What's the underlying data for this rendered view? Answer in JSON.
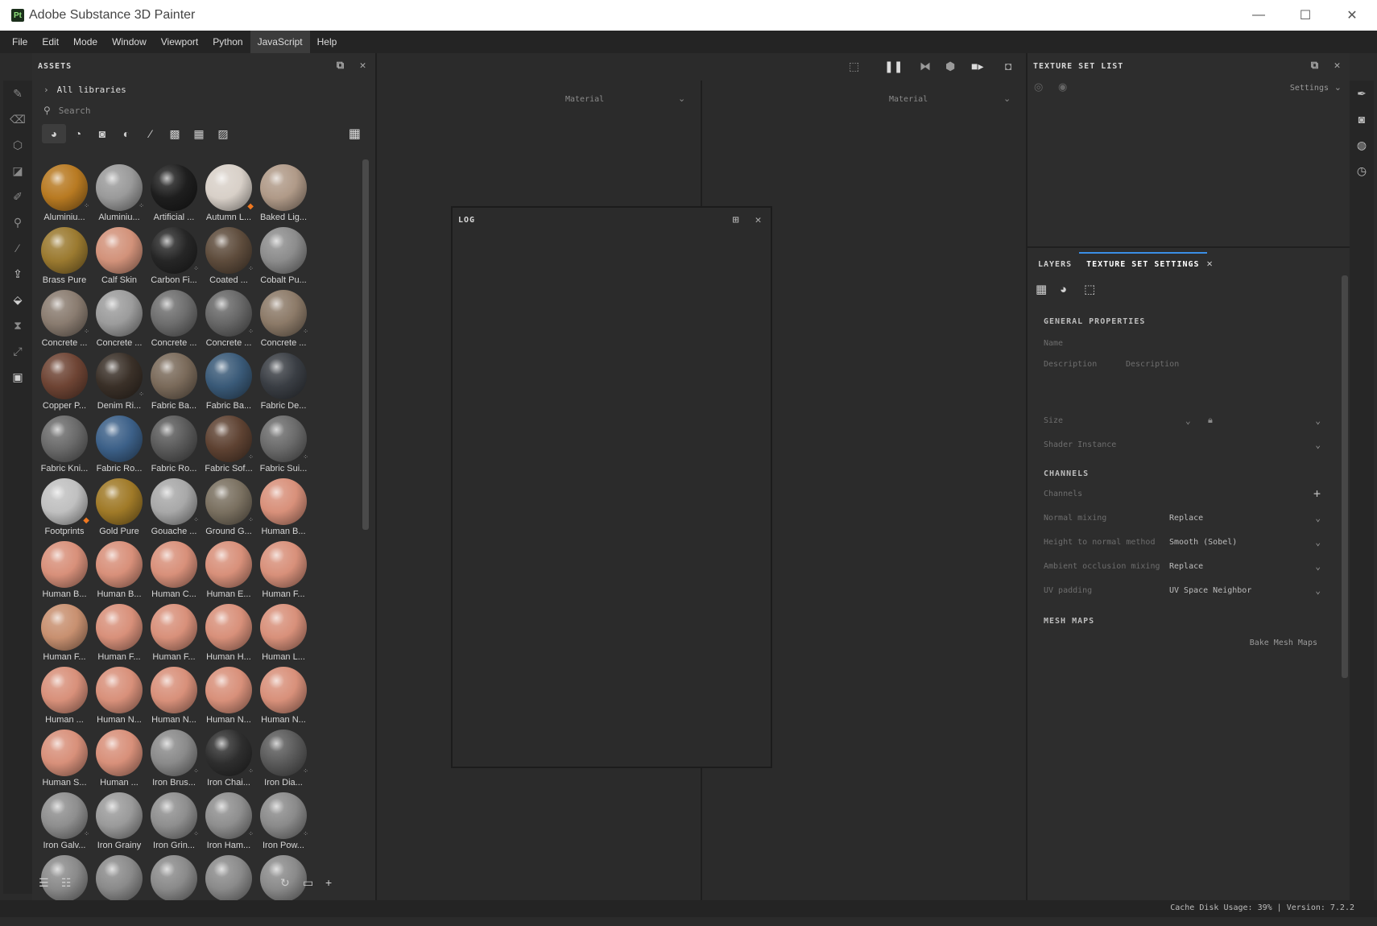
{
  "window": {
    "logo": "Pt",
    "title": "Adobe Substance 3D Painter",
    "minimize": "—",
    "maximize": "☐",
    "close": "✕"
  },
  "menu": [
    "File",
    "Edit",
    "Mode",
    "Window",
    "Viewport",
    "Python",
    "JavaScript",
    "Help"
  ],
  "assets": {
    "title": "ASSETS",
    "libraries": "All libraries",
    "search_placeholder": "Search",
    "items": [
      {
        "label": "Aluminiu...",
        "color": "#b87a22",
        "badge": "dots"
      },
      {
        "label": "Aluminiu...",
        "color": "#9a9a9a",
        "badge": "dots"
      },
      {
        "label": "Artificial ...",
        "color": "#1e1e1e",
        "badge": ""
      },
      {
        "label": "Autumn L...",
        "color": "#d8d0c8",
        "badge": "leaf"
      },
      {
        "label": "Baked Lig...",
        "color": "#b09a88",
        "badge": ""
      },
      {
        "label": "Brass Pure",
        "color": "#9b7a30",
        "badge": ""
      },
      {
        "label": "Calf Skin",
        "color": "#d2927a",
        "badge": ""
      },
      {
        "label": "Carbon Fi...",
        "color": "#262626",
        "badge": "dots"
      },
      {
        "label": "Coated ...",
        "color": "#5e4c3c",
        "badge": "dots"
      },
      {
        "label": "Cobalt Pu...",
        "color": "#8c8c8c",
        "badge": ""
      },
      {
        "label": "Concrete ...",
        "color": "#8a7c70",
        "badge": "dots"
      },
      {
        "label": "Concrete ...",
        "color": "#9c9c9c",
        "badge": ""
      },
      {
        "label": "Concrete ...",
        "color": "#6e6e6e",
        "badge": ""
      },
      {
        "label": "Concrete ...",
        "color": "#676767",
        "badge": "dots"
      },
      {
        "label": "Concrete ...",
        "color": "#8c7a68",
        "badge": "dots"
      },
      {
        "label": "Copper P...",
        "color": "#6e4434",
        "badge": ""
      },
      {
        "label": "Denim Ri...",
        "color": "#3a3028",
        "badge": "dots"
      },
      {
        "label": "Fabric Ba...",
        "color": "#7a6a5a",
        "badge": ""
      },
      {
        "label": "Fabric Ba...",
        "color": "#3a5a78",
        "badge": ""
      },
      {
        "label": "Fabric De...",
        "color": "#3a3e44",
        "badge": ""
      },
      {
        "label": "Fabric Kni...",
        "color": "#6a6a6a",
        "badge": ""
      },
      {
        "label": "Fabric Ro...",
        "color": "#3c6088",
        "badge": ""
      },
      {
        "label": "Fabric Ro...",
        "color": "#5a5a5a",
        "badge": ""
      },
      {
        "label": "Fabric Sof...",
        "color": "#5e4232",
        "badge": "dots"
      },
      {
        "label": "Fabric Sui...",
        "color": "#6a6a6a",
        "badge": "dots"
      },
      {
        "label": "Footprints",
        "color": "#c0c0c0",
        "badge": "leaf"
      },
      {
        "label": "Gold Pure",
        "color": "#a07a28",
        "badge": ""
      },
      {
        "label": "Gouache ...",
        "color": "#a8a8a8",
        "badge": "dots"
      },
      {
        "label": "Ground G...",
        "color": "#7a7060",
        "badge": "dots"
      },
      {
        "label": "Human B...",
        "color": "#d8907a",
        "badge": ""
      },
      {
        "label": "Human B...",
        "color": "#d8907a",
        "badge": ""
      },
      {
        "label": "Human B...",
        "color": "#d8907a",
        "badge": ""
      },
      {
        "label": "Human C...",
        "color": "#d8907a",
        "badge": ""
      },
      {
        "label": "Human E...",
        "color": "#d8907a",
        "badge": ""
      },
      {
        "label": "Human F...",
        "color": "#d8907a",
        "badge": ""
      },
      {
        "label": "Human F...",
        "color": "#c89070",
        "badge": ""
      },
      {
        "label": "Human F...",
        "color": "#d8907a",
        "badge": ""
      },
      {
        "label": "Human F...",
        "color": "#d8907a",
        "badge": ""
      },
      {
        "label": "Human H...",
        "color": "#d8907a",
        "badge": ""
      },
      {
        "label": "Human L...",
        "color": "#d8907a",
        "badge": ""
      },
      {
        "label": "Human ...",
        "color": "#d8907a",
        "badge": ""
      },
      {
        "label": "Human N...",
        "color": "#d8907a",
        "badge": ""
      },
      {
        "label": "Human N...",
        "color": "#d8907a",
        "badge": ""
      },
      {
        "label": "Human N...",
        "color": "#d8907a",
        "badge": ""
      },
      {
        "label": "Human N...",
        "color": "#d8907a",
        "badge": ""
      },
      {
        "label": "Human S...",
        "color": "#d8907a",
        "badge": ""
      },
      {
        "label": "Human ...",
        "color": "#d8907a",
        "badge": ""
      },
      {
        "label": "Iron Brus...",
        "color": "#8a8a8a",
        "badge": "dots"
      },
      {
        "label": "Iron Chai...",
        "color": "#2e2e2e",
        "badge": "dots"
      },
      {
        "label": "Iron Dia...",
        "color": "#5a5a5a",
        "badge": "dots"
      },
      {
        "label": "Iron Galv...",
        "color": "#8e8e8e",
        "badge": "dots"
      },
      {
        "label": "Iron Grainy",
        "color": "#9a9a9a",
        "badge": ""
      },
      {
        "label": "Iron Grin...",
        "color": "#8e8e8e",
        "badge": "dots"
      },
      {
        "label": "Iron Ham...",
        "color": "#8e8e8e",
        "badge": "dots"
      },
      {
        "label": "Iron Pow...",
        "color": "#8a8a8a",
        "badge": "dots"
      },
      {
        "label": "",
        "color": "#8a8a8a",
        "badge": ""
      },
      {
        "label": "",
        "color": "#8a8a8a",
        "badge": ""
      },
      {
        "label": "",
        "color": "#8a8a8a",
        "badge": ""
      },
      {
        "label": "",
        "color": "#8a8a8a",
        "badge": ""
      },
      {
        "label": "",
        "color": "#8a8a8a",
        "badge": ""
      }
    ]
  },
  "viewport": {
    "left_material": "Material",
    "right_material": "Material"
  },
  "log": {
    "title": "LOG"
  },
  "texture_set_list": {
    "title": "TEXTURE SET LIST",
    "settings_label": "Settings"
  },
  "settings_panel": {
    "tabs": [
      "LAYERS",
      "TEXTURE SET SETTINGS"
    ],
    "general_title": "GENERAL PROPERTIES",
    "name_label": "Name",
    "description_label": "Description",
    "description_placeholder": "Description",
    "size_label": "Size",
    "shader_label": "Shader Instance",
    "channels_title": "CHANNELS",
    "channels_label": "Channels",
    "normal_mixing_label": "Normal mixing",
    "normal_mixing_value": "Replace",
    "height_method_label": "Height to normal method",
    "height_method_value": "Smooth (Sobel)",
    "ao_mixing_label": "Ambient occlusion mixing",
    "ao_mixing_value": "Replace",
    "uv_padding_label": "UV padding",
    "uv_padding_value": "UV Space Neighbor",
    "mesh_maps_title": "MESH MAPS",
    "bake_button": "Bake Mesh Maps"
  },
  "status": {
    "text": "Cache Disk Usage:    39% | Version: 7.2.2"
  }
}
